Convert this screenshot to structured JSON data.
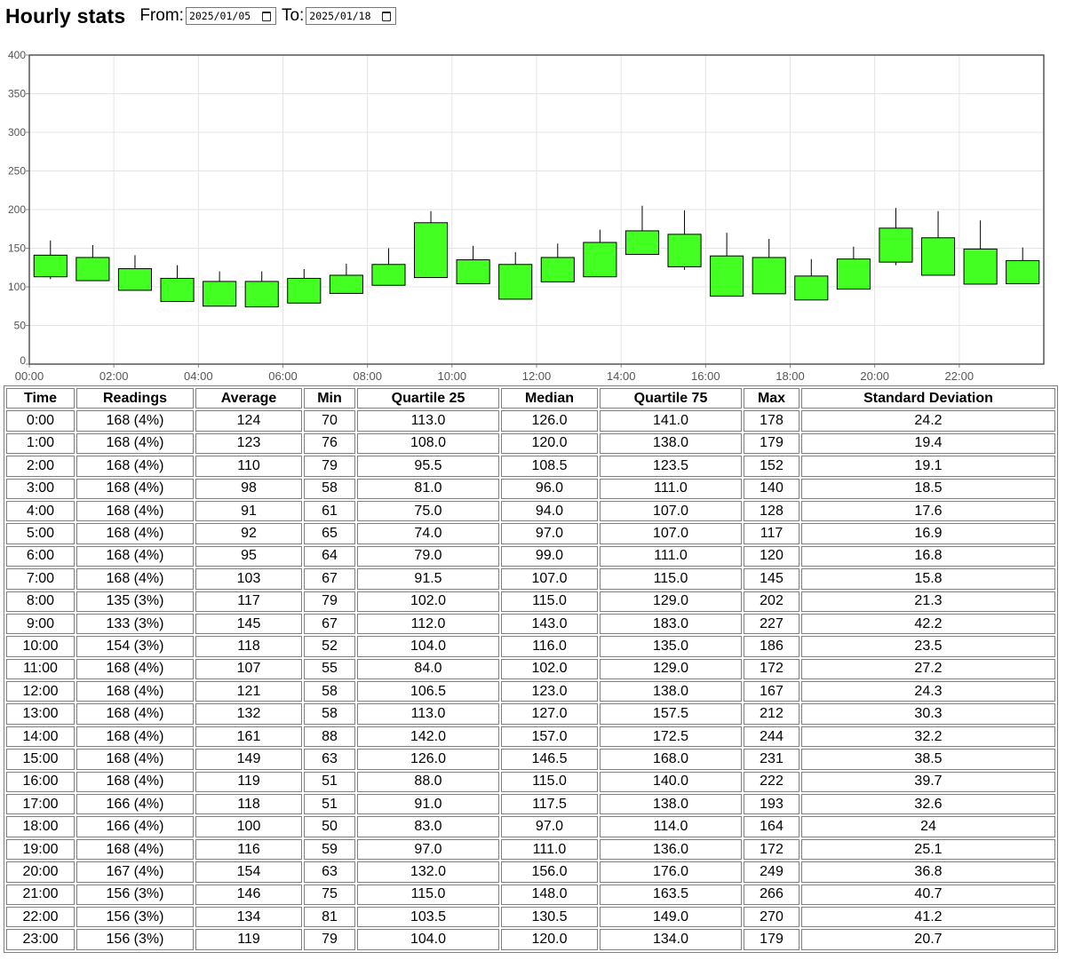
{
  "header": {
    "title": "Hourly stats",
    "from_label": "From:",
    "from_value": "2025/01/05",
    "to_label": "To:",
    "to_value": "2025/01/18"
  },
  "chart_data": {
    "type": "candlestick",
    "title": "",
    "xlabel": "",
    "ylabel": "",
    "ylim": [
      0,
      400
    ],
    "yticks": [
      0,
      50,
      100,
      150,
      200,
      250,
      300,
      350,
      400
    ],
    "xtick_labels": [
      "00:00",
      "02:00",
      "04:00",
      "06:00",
      "08:00",
      "10:00",
      "12:00",
      "14:00",
      "16:00",
      "18:00",
      "20:00",
      "22:00"
    ],
    "grid": true,
    "body_color": "#44ff22",
    "wick_color": "#000000",
    "x": [
      0,
      1,
      2,
      3,
      4,
      5,
      6,
      7,
      8,
      9,
      10,
      11,
      12,
      13,
      14,
      15,
      16,
      17,
      18,
      19,
      20,
      21,
      22,
      23
    ],
    "low": [
      110,
      108,
      95.5,
      81,
      75,
      74,
      79,
      91.5,
      102,
      112,
      104,
      84,
      106.5,
      113,
      142,
      122,
      88,
      91,
      83,
      97,
      128,
      115,
      103.5,
      104
    ],
    "q25": [
      113,
      108,
      95.5,
      81,
      75,
      74,
      79,
      91.5,
      102,
      112,
      104,
      84,
      106.5,
      113,
      142,
      126,
      88,
      91,
      83,
      97,
      132,
      115,
      103.5,
      104
    ],
    "q75": [
      141,
      138,
      123.5,
      111,
      107,
      107,
      111,
      115,
      129,
      183,
      135,
      129,
      138,
      157.5,
      172.5,
      168,
      140,
      138,
      114,
      136,
      176,
      163.5,
      149,
      134
    ],
    "high": [
      160,
      154,
      141,
      128,
      120,
      120,
      123,
      130,
      150,
      198,
      153,
      145,
      156,
      174,
      205,
      199,
      170,
      162,
      136,
      152,
      202,
      198,
      186,
      151
    ]
  },
  "table": {
    "headers": [
      "Time",
      "Readings",
      "Average",
      "Min",
      "Quartile 25",
      "Median",
      "Quartile 75",
      "Max",
      "Standard Deviation"
    ],
    "rows": [
      [
        "0:00",
        "168 (4%)",
        "124",
        "70",
        "113.0",
        "126.0",
        "141.0",
        "178",
        "24.2"
      ],
      [
        "1:00",
        "168 (4%)",
        "123",
        "76",
        "108.0",
        "120.0",
        "138.0",
        "179",
        "19.4"
      ],
      [
        "2:00",
        "168 (4%)",
        "110",
        "79",
        "95.5",
        "108.5",
        "123.5",
        "152",
        "19.1"
      ],
      [
        "3:00",
        "168 (4%)",
        "98",
        "58",
        "81.0",
        "96.0",
        "111.0",
        "140",
        "18.5"
      ],
      [
        "4:00",
        "168 (4%)",
        "91",
        "61",
        "75.0",
        "94.0",
        "107.0",
        "128",
        "17.6"
      ],
      [
        "5:00",
        "168 (4%)",
        "92",
        "65",
        "74.0",
        "97.0",
        "107.0",
        "117",
        "16.9"
      ],
      [
        "6:00",
        "168 (4%)",
        "95",
        "64",
        "79.0",
        "99.0",
        "111.0",
        "120",
        "16.8"
      ],
      [
        "7:00",
        "168 (4%)",
        "103",
        "67",
        "91.5",
        "107.0",
        "115.0",
        "145",
        "15.8"
      ],
      [
        "8:00",
        "135 (3%)",
        "117",
        "79",
        "102.0",
        "115.0",
        "129.0",
        "202",
        "21.3"
      ],
      [
        "9:00",
        "133 (3%)",
        "145",
        "67",
        "112.0",
        "143.0",
        "183.0",
        "227",
        "42.2"
      ],
      [
        "10:00",
        "154 (3%)",
        "118",
        "52",
        "104.0",
        "116.0",
        "135.0",
        "186",
        "23.5"
      ],
      [
        "11:00",
        "168 (4%)",
        "107",
        "55",
        "84.0",
        "102.0",
        "129.0",
        "172",
        "27.2"
      ],
      [
        "12:00",
        "168 (4%)",
        "121",
        "58",
        "106.5",
        "123.0",
        "138.0",
        "167",
        "24.3"
      ],
      [
        "13:00",
        "168 (4%)",
        "132",
        "58",
        "113.0",
        "127.0",
        "157.5",
        "212",
        "30.3"
      ],
      [
        "14:00",
        "168 (4%)",
        "161",
        "88",
        "142.0",
        "157.0",
        "172.5",
        "244",
        "32.2"
      ],
      [
        "15:00",
        "168 (4%)",
        "149",
        "63",
        "126.0",
        "146.5",
        "168.0",
        "231",
        "38.5"
      ],
      [
        "16:00",
        "168 (4%)",
        "119",
        "51",
        "88.0",
        "115.0",
        "140.0",
        "222",
        "39.7"
      ],
      [
        "17:00",
        "166 (4%)",
        "118",
        "51",
        "91.0",
        "117.5",
        "138.0",
        "193",
        "32.6"
      ],
      [
        "18:00",
        "166 (4%)",
        "100",
        "50",
        "83.0",
        "97.0",
        "114.0",
        "164",
        "24"
      ],
      [
        "19:00",
        "168 (4%)",
        "116",
        "59",
        "97.0",
        "111.0",
        "136.0",
        "172",
        "25.1"
      ],
      [
        "20:00",
        "167 (4%)",
        "154",
        "63",
        "132.0",
        "156.0",
        "176.0",
        "249",
        "36.8"
      ],
      [
        "21:00",
        "156 (3%)",
        "146",
        "75",
        "115.0",
        "148.0",
        "163.5",
        "266",
        "40.7"
      ],
      [
        "22:00",
        "156 (3%)",
        "134",
        "81",
        "103.5",
        "130.5",
        "149.0",
        "270",
        "41.2"
      ],
      [
        "23:00",
        "156 (3%)",
        "119",
        "79",
        "104.0",
        "120.0",
        "134.0",
        "179",
        "20.7"
      ]
    ]
  }
}
